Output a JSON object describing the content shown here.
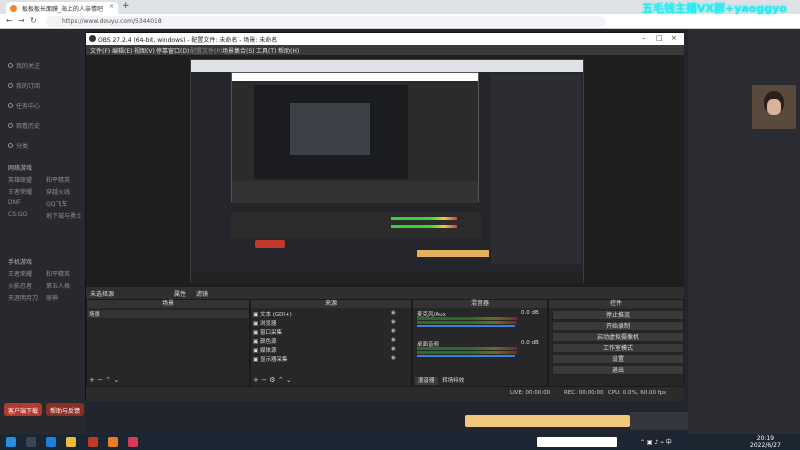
{
  "browser": {
    "tab_title": "板板板长面膜_海上的人亲情吧",
    "url": "https://www.douyu.com/5344018",
    "overlay_ad": "五毛钱主播VX群+yaoggyo"
  },
  "sidebar": {
    "items": [
      "我的关注",
      "我的订阅",
      "任务中心",
      "观看历史",
      "分类"
    ],
    "section_hot": "网络游戏",
    "hot_games": [
      "英雄联盟",
      "和平精英",
      "王者荣耀",
      "穿越火线",
      "DNF",
      "QQ飞车",
      "CS:GO",
      "地下城与勇士"
    ],
    "section_mobile": "手机游戏",
    "mobile_games": [
      "王者荣耀",
      "和平精英",
      "火影忍者",
      "第五人格",
      "天涯明月刀",
      "原神"
    ],
    "btn_left": "客户端下载",
    "btn_right": "帮助与反馈"
  },
  "obs": {
    "title": "OBS 27.2.4 (64-bit, windows) - 配置文件: 未命名 - 场景: 未命名",
    "menu": [
      "文件(F)",
      "编辑(E)",
      "视图(V)",
      "停靠窗口(D)",
      "配置文件(P)",
      "场景集合(S)",
      "工具(T)",
      "帮助(H)"
    ],
    "scene_label": "未选择源",
    "btn_props": "属性",
    "btn_filters": "滤镜",
    "docks": {
      "scenes": "场景",
      "sources": "来源",
      "mixer": "混音器",
      "controls": "控件"
    },
    "scene_items": [
      "场景"
    ],
    "sources": [
      {
        "name": "文本 (GDI+)"
      },
      {
        "name": "浏览器"
      },
      {
        "name": "窗口采集"
      },
      {
        "name": "颜色源"
      },
      {
        "name": "媒体源"
      },
      {
        "name": "显示器采集"
      }
    ],
    "mixer": [
      {
        "name": "麦克风/Aux",
        "db": "0.0 dB"
      },
      {
        "name": "桌面音频",
        "db": "0.0 dB"
      }
    ],
    "mixer_tabs": [
      "混音器",
      "转场特效"
    ],
    "controls": [
      "停止推流",
      "开始录制",
      "启动虚拟摄像机",
      "工作室模式",
      "设置",
      "退出"
    ],
    "status": {
      "live": "LIVE: 00:00:00",
      "rec": "REC: 00:00:00",
      "cpu": "CPU: 0.0%, 60.00 fps"
    }
  },
  "taskbar": {
    "time": "20:19",
    "date": "2022/6/27"
  }
}
